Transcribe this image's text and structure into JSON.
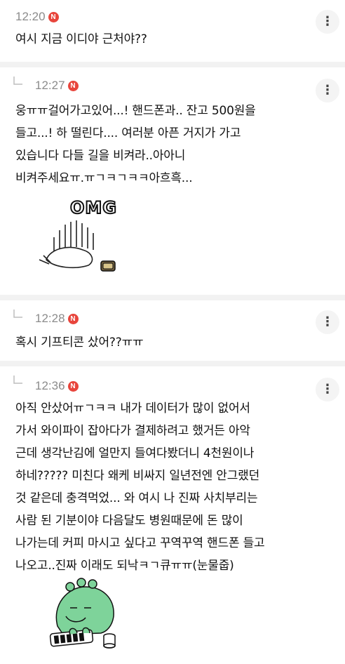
{
  "comments": [
    {
      "time": "12:20",
      "badge": "N",
      "text": "여시 지금 이디야 근처야??",
      "more_icon": "more-vertical-icon"
    },
    {
      "time": "12:27",
      "badge": "N",
      "text": "웅ㅠㅠ걸어가고있어...! 핸드폰과.. 잔고 500원을\n들고...! 하 떨린다.... 여러분 아픈 거지가 가고\n있습니다 다들 길을 비켜라..아아니\n비켜주세요ㅠ.ㅠㄱㅋㄱㅋㅋ아흐흑...",
      "sticker": "OMG",
      "more_icon": "more-vertical-icon"
    },
    {
      "time": "12:28",
      "badge": "N",
      "text": "혹시 기프티콘 샀어??ㅠㅠ",
      "more_icon": "more-vertical-icon"
    },
    {
      "time": "12:36",
      "badge": "N",
      "text": "아직 안샀어ㅠㄱㅋㅋ 내가 데이터가 많이 없어서\n가서 와이파이 잡아다가 결제하려고 했거든 아악\n근데 생각난김에 얼만지 들여다봤더니 4천원이나\n하네????? 미친다 왜케 비싸지 일년전엔 안그랬던\n것 같은데 충격먹었... 와 여시 나 진짜 사치부리는\n사람 된 기분이야 다음달도 병원때문에 돈 많이\n나가는데 커피 마시고 싶다고 꾸역꾸역 핸드폰 들고\n나오고..진짜 이래도 되낙ㅋㄱ큐ㅠㅠ(눈물줍)",
      "more_icon": "more-vertical-icon"
    }
  ]
}
